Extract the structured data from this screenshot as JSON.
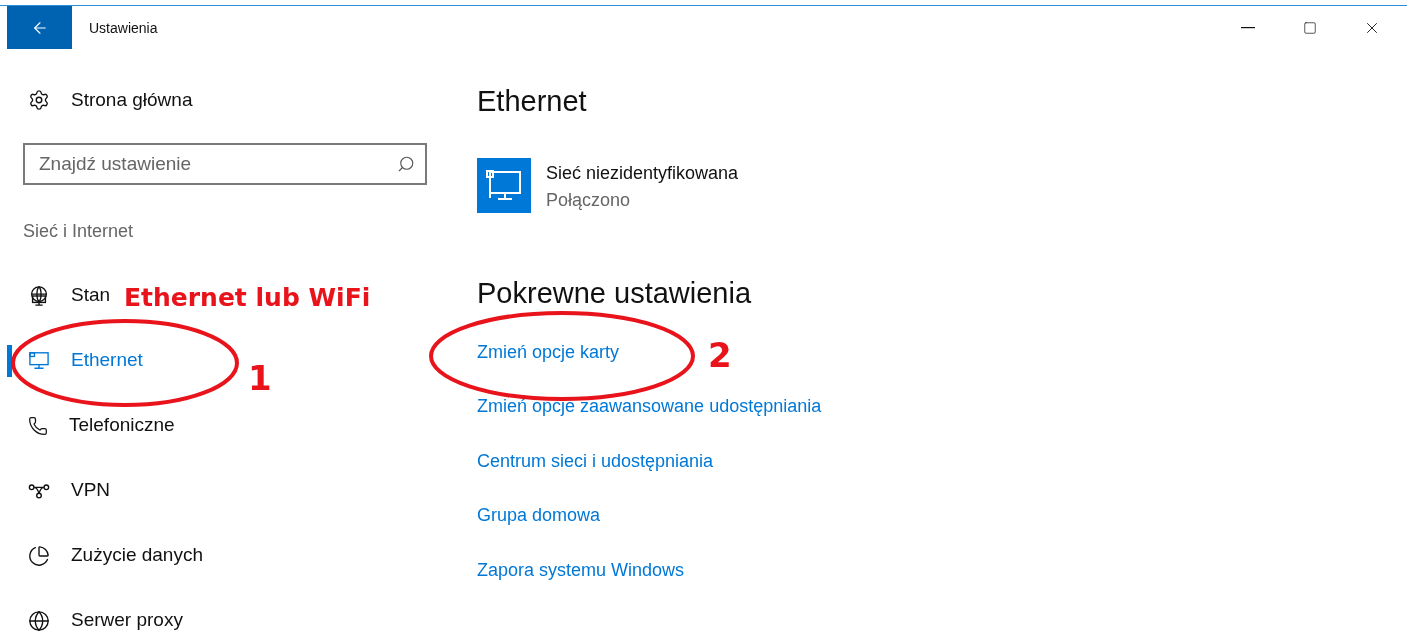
{
  "window": {
    "title": "Ustawienia"
  },
  "sidebar": {
    "home": "Strona główna",
    "search": {
      "placeholder": "Znajdź ustawienie"
    },
    "section": "Sieć i Internet",
    "items": [
      {
        "label": "Stan",
        "kind": "status",
        "selected": false
      },
      {
        "label": "Ethernet",
        "kind": "ethernet",
        "selected": true
      },
      {
        "label": "Telefoniczne",
        "kind": "dialup",
        "selected": false
      },
      {
        "label": "VPN",
        "kind": "vpn",
        "selected": false
      },
      {
        "label": "Zużycie danych",
        "kind": "data",
        "selected": false
      },
      {
        "label": "Serwer proxy",
        "kind": "proxy",
        "selected": false
      }
    ]
  },
  "content": {
    "title": "Ethernet",
    "network": {
      "name": "Sieć niezidentyfikowana",
      "status": "Połączono"
    },
    "related_title": "Pokrewne ustawienia",
    "links": [
      "Zmień opcje karty",
      "Zmień opcje zaawansowane udostępniania",
      "Centrum sieci i udostępniania",
      "Grupa domowa",
      "Zapora systemu Windows"
    ]
  },
  "annotations": {
    "note": "Ethernet lub WiFi",
    "callouts": [
      "1",
      "2"
    ]
  }
}
